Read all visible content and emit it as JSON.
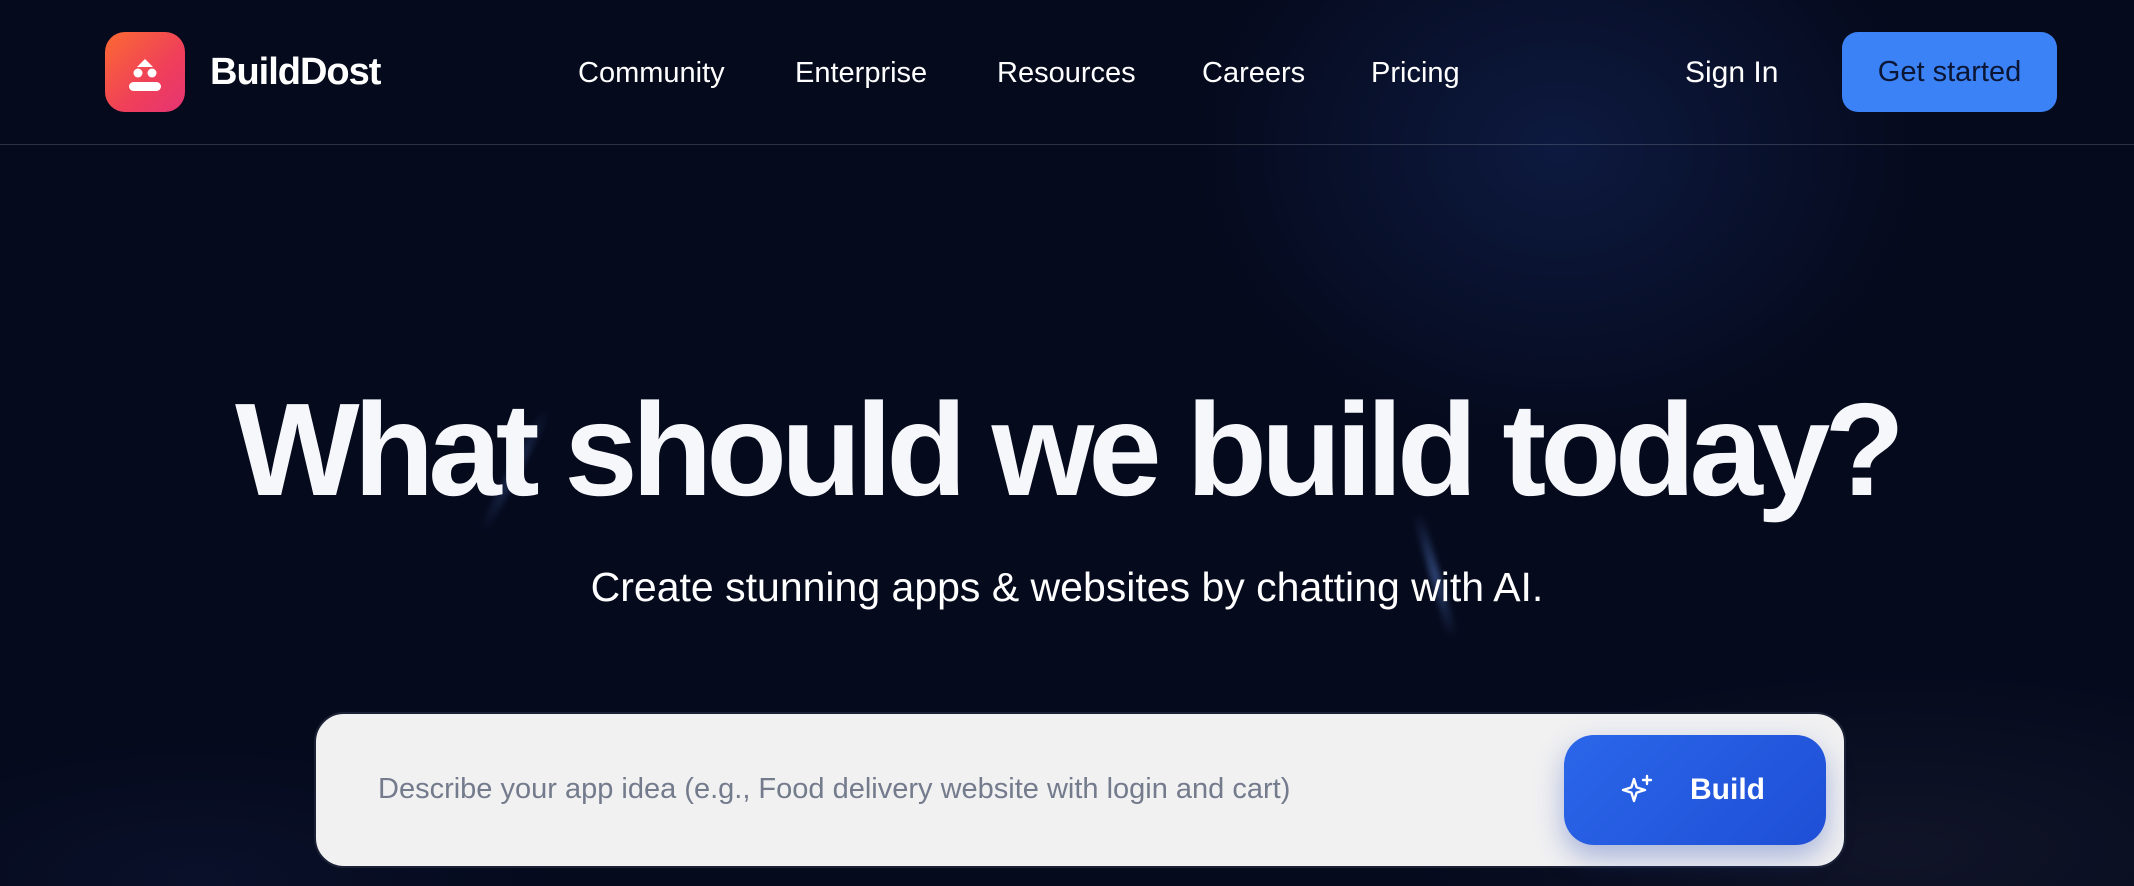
{
  "header": {
    "brand": "BuildDost",
    "nav": {
      "community": "Community",
      "enterprise": "Enterprise",
      "resources": "Resources",
      "careers": "Careers",
      "pricing": "Pricing"
    },
    "sign_in": "Sign In",
    "get_started": "Get started",
    "logo_icon": "robot-icon"
  },
  "hero": {
    "title": "What should we build today?",
    "subtitle": "Create stunning apps & websites by chatting with AI."
  },
  "prompt": {
    "placeholder": "Describe your app idea (e.g., Food delivery website with login and cart)",
    "value": "",
    "button_label": "Build",
    "button_icon": "sparkles-icon"
  },
  "colors": {
    "background": "#050a1d",
    "accent": "#3b82f6",
    "build_button": "#2456df",
    "logo_gradient_start": "#fb6a32",
    "logo_gradient_end": "#e53474"
  }
}
